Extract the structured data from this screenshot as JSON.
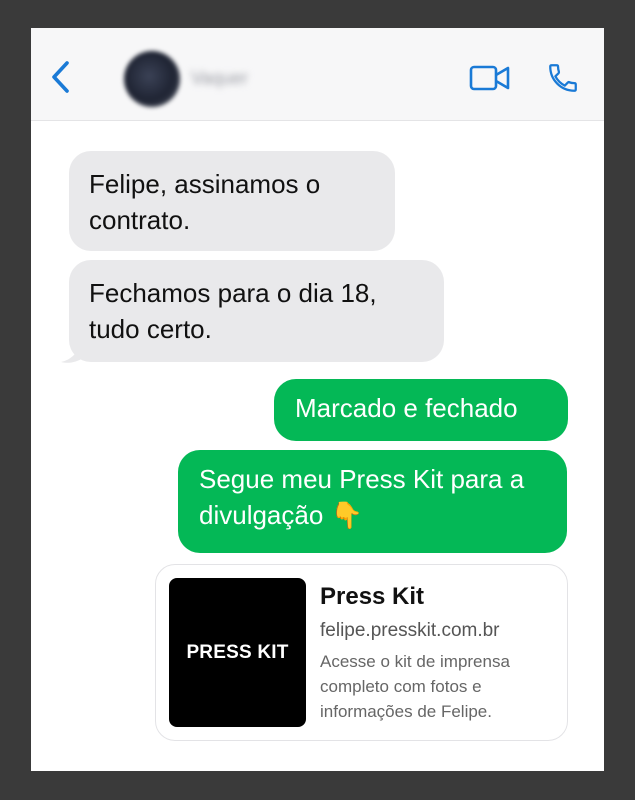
{
  "header": {
    "contact_name": "Vaquer",
    "back_icon": "chevron-left-icon",
    "video_icon": "video-camera-icon",
    "phone_icon": "phone-icon",
    "accent_color": "#1a7ad6"
  },
  "messages": [
    {
      "direction": "incoming",
      "text": "Felipe, assinamos o contrato."
    },
    {
      "direction": "incoming",
      "text": "Fechamos para o dia 18, tudo certo."
    },
    {
      "direction": "outgoing",
      "text": "Marcado e fechado"
    },
    {
      "direction": "outgoing",
      "text": "Segue meu Press Kit para a divulgação 👇"
    }
  ],
  "link_preview": {
    "thumbnail_text": "PRESS KIT",
    "title": "Press Kit",
    "url": "felipe.presskit.com.br",
    "description": "Acesse o kit de imprensa completo com fotos e informações de Felipe."
  },
  "colors": {
    "outgoing_bubble": "#04b856",
    "incoming_bubble": "#e9e9eb",
    "frame_border": "#3a3a3a"
  }
}
